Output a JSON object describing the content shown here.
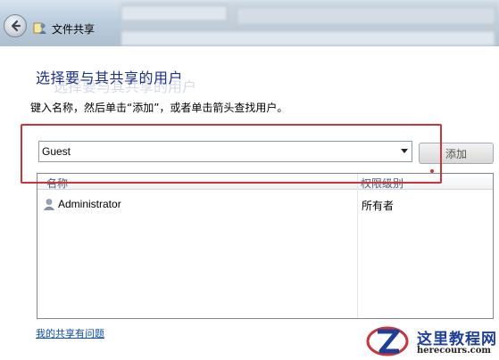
{
  "window": {
    "title": "文件共享",
    "back_icon": "back-arrow-icon",
    "app_icon": "file-share-icon"
  },
  "dialog": {
    "heading": "选择要与其共享的用户",
    "instruction": "键入名称，然后单击“添加”，或者单击箭头查找用户。"
  },
  "combo": {
    "value": "Guest"
  },
  "add_button": {
    "label": "添加"
  },
  "list": {
    "columns": [
      "名称",
      "权限级别"
    ],
    "rows": [
      {
        "name": "Administrator",
        "level": "所有者",
        "icon": "user-icon"
      }
    ]
  },
  "footer": {
    "help_link": "我的共享有问题"
  },
  "watermark": {
    "title": "这里教程网",
    "url": "herecours.com"
  },
  "colors": {
    "highlight": "#c8353a",
    "heading": "#1e3287",
    "link": "#0b4fa8"
  }
}
